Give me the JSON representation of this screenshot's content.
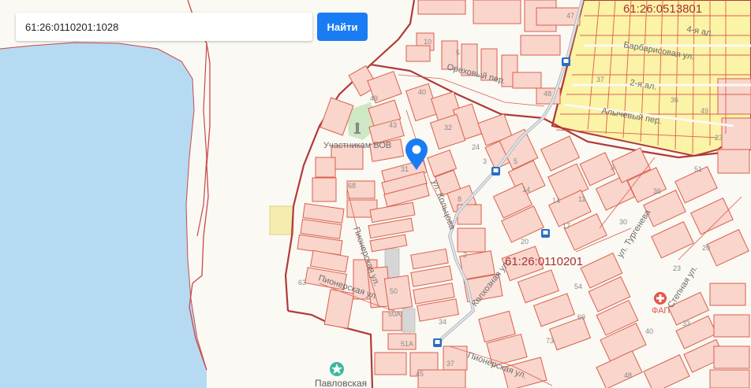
{
  "search": {
    "value": "61:26:0110201:1028",
    "button_label": "Найти"
  },
  "map": {
    "cadastral_blocks": [
      "61:26:0513801",
      "61:26:0110201"
    ],
    "streets": [
      "Ореховый пер.",
      "ул. Кольцова",
      "Пионерская ул.",
      "Пионерская ул.",
      "Колхозная ул.",
      "Пионерская ул.",
      "ул. Тургенева",
      "Степная ул.",
      "Барбарисовая ул.",
      "2-я ал.",
      "4-я ал.",
      "Алычевый пер."
    ],
    "poi": [
      {
        "label": "Участникам ВОВ",
        "icon": "monument-icon"
      },
      {
        "label": "ФАП",
        "icon": "medical-cross-icon"
      },
      {
        "label": "Павловская",
        "icon": "star-icon"
      }
    ],
    "house_numbers": [
      "47",
      "10",
      "5",
      "49",
      "40",
      "43",
      "32",
      "24",
      "31",
      "68",
      "8",
      "2",
      "3",
      "5",
      "14",
      "11",
      "20",
      "14",
      "17",
      "30",
      "3",
      "63",
      "50",
      "50А",
      "51А",
      "45",
      "37",
      "34",
      "54",
      "69",
      "73",
      "48",
      "40",
      "33",
      "23",
      "36",
      "20",
      "51",
      "23",
      "48",
      "36",
      "37",
      "49"
    ],
    "colors": {
      "water": "#b6daf2",
      "land": "#fbf9f3",
      "parcel_fill": "#f9d5cb",
      "parcel_border": "#d9604f",
      "block_border": "#b03a3a",
      "selected_block": "#fbf3a6",
      "pin": "#1a7cf2",
      "road": "#b9bcc2"
    }
  }
}
